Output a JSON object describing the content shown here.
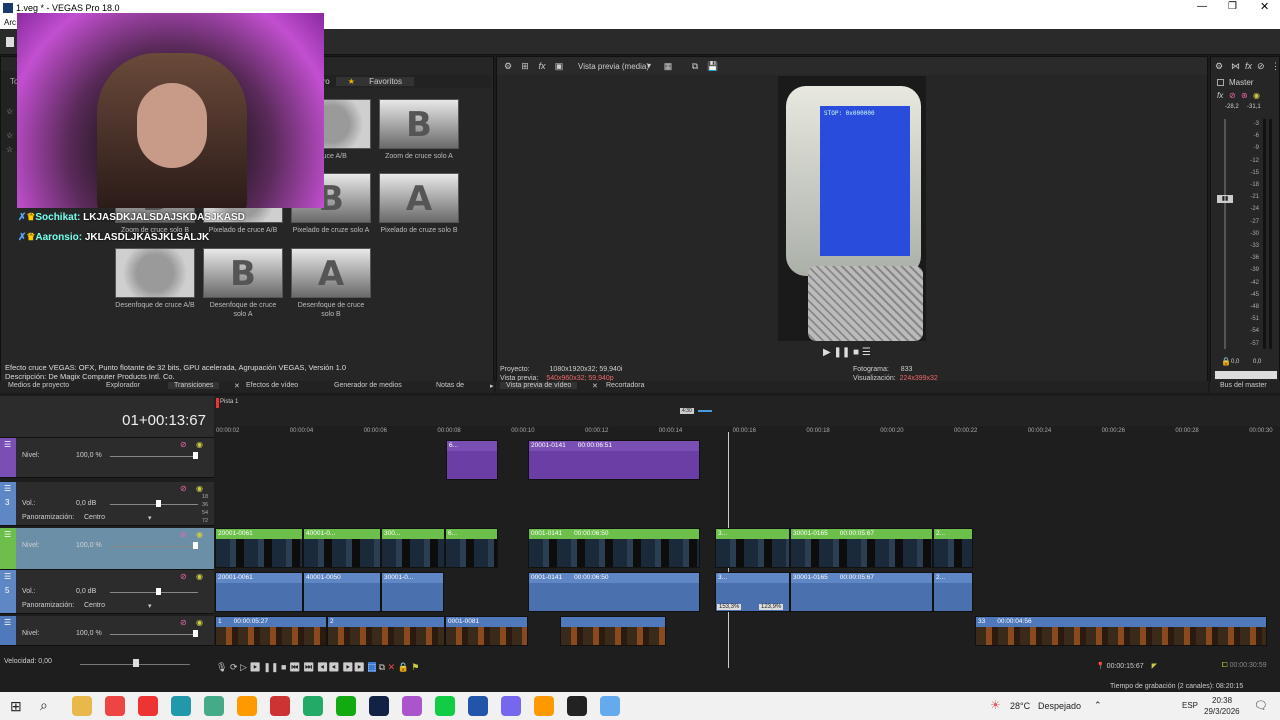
{
  "window": {
    "title": "1.veg * - VEGAS Pro 18.0",
    "menu_fragment": "Arc"
  },
  "transitions": {
    "partial_tabs": [
      "To",
      "ercero"
    ],
    "favorites_tab": "Favoritos",
    "items": [
      {
        "label": "Cruce A/B",
        "glyph": ""
      },
      {
        "label": "Zoom de cruce solo A",
        "glyph": "B"
      },
      {
        "label": "Zoom de cruce solo B",
        "glyph": "B"
      },
      {
        "label": "Pixelado de cruce A/B",
        "glyph": ""
      },
      {
        "label": "Pixelado de cruze solo A",
        "glyph": "B"
      },
      {
        "label": "Pixelado de cruze solo B",
        "glyph": "A"
      },
      {
        "label": "Desenfoque de cruce A/B",
        "glyph": ""
      },
      {
        "label": "Desenfoque de cruce solo A",
        "glyph": "B"
      },
      {
        "label": "Desenfoque de cruce solo B",
        "glyph": "A"
      }
    ],
    "desc1": "Efecto cruce VEGAS: OFX, Punto flotante de 32 bits, GPU acelerada, Agrupación VEGAS, Versión 1.0",
    "desc2": "Descripción: De Magix Computer Products Intl. Co.",
    "bottom_tabs": [
      "Medios de proyecto",
      "Explorador",
      "Transiciones",
      "Efectos de vídeo",
      "Generador de medios",
      "Notas de"
    ]
  },
  "chat": [
    {
      "user": "Sochikat:",
      "message": "LKJASDKJALSDAJSKDASJKASD"
    },
    {
      "user": "Aaronsio:",
      "message": "JKLASDLJKASJKLSALJK"
    }
  ],
  "preview": {
    "mode": "Vista previa (media)",
    "screen_text": "STOP: 0x000000",
    "project_label": "Proyecto:",
    "project_value": "1080x1920x32; 59,940i",
    "vista_label": "Vista previa:",
    "vista_value": "540x960x32; 59,940p",
    "frame_label": "Fotograma:",
    "frame_value": "833",
    "visual_label": "Visualización:",
    "visual_value": "224x399x32",
    "tabs": [
      "Vista previa de vídeo",
      "Recortadora"
    ]
  },
  "master": {
    "title": "Master",
    "left_peak": "-28,2",
    "right_peak": "-31,1",
    "scale": [
      "-3",
      "-6",
      "-9",
      "-12",
      "-15",
      "-18",
      "-21",
      "-24",
      "-27",
      "-30",
      "-33",
      "-36",
      "-39",
      "-42",
      "-45",
      "-48",
      "-51",
      "-54",
      "-57"
    ],
    "bottom_left": "0,0",
    "bottom_right": "0,0",
    "tab": "Bus del master"
  },
  "timeline": {
    "timecode": "01+00:13:67",
    "marker": "Pista 1",
    "loop_label": "4:30",
    "ruler": [
      "00:00:02",
      "00:00:04",
      "00:00:06",
      "00:00:08",
      "00:00:10",
      "00:00:12",
      "00:00:14",
      "00:00:16",
      "00:00:18",
      "00:00:20",
      "00:00:22",
      "00:00:24",
      "00:00:26",
      "00:00:28",
      "00:00:30"
    ],
    "tracks": [
      {
        "num": "",
        "label": "Nivel:",
        "value": "100,0 %"
      },
      {
        "num": "3",
        "label": "Vol.:",
        "value": "0,0 dB",
        "label2": "Panoramización:",
        "value2": "Centro"
      },
      {
        "num": "",
        "label": "Nivel:",
        "value": "100,0 %"
      },
      {
        "num": "5",
        "label": "Vol.:",
        "value": "0,0 dB",
        "label2": "Panoramización:",
        "value2": "Centro"
      },
      {
        "num": "",
        "label": "Nivel:",
        "value": "100,0 %"
      }
    ],
    "db_scale": [
      "18",
      "36",
      "54",
      "72"
    ],
    "clips": {
      "purple": [
        {
          "name": "6..."
        },
        {
          "name": "20001-0141",
          "time": "00:00:06:51"
        }
      ],
      "green": [
        {
          "name": "20001-0061"
        },
        {
          "name": "40001-0..."
        },
        {
          "name": "300..."
        },
        {
          "name": "6..."
        },
        {
          "name": "0001-0141",
          "time": "00:00:06:50"
        },
        {
          "name": "3..."
        },
        {
          "name": "30001-0165",
          "time": "00:00:05:67"
        },
        {
          "name": "2..."
        }
      ],
      "audio": [
        {
          "name": "20001-0061"
        },
        {
          "name": "40001-0050"
        },
        {
          "name": "30001-0..."
        },
        {
          "name": "0001-0141",
          "time": "00:00:06:50"
        },
        {
          "name": "3..."
        },
        {
          "name": "30001-0165",
          "time": "00:00:05:67"
        },
        {
          "name": "2..."
        }
      ],
      "audio_pct": [
        "153,3%",
        "123,9%"
      ],
      "blue": [
        {
          "name": "1",
          "time": "00:00:05:27"
        },
        {
          "name": "2"
        },
        {
          "name": "0001-0081"
        },
        {
          "name": "33",
          "time": "00:00:04:56"
        }
      ]
    },
    "speed_label": "Velocidad: 0,00",
    "cursor_time": "00:00:15:67",
    "end_time": "00:00:30:59",
    "rec_time": "Tiempo de grabación (2 canales): 08:20:15"
  },
  "taskbar": {
    "temp": "28°C",
    "weather": "Despejado",
    "lang": "ESP",
    "time": "20:38",
    "date": "29/3/2026"
  }
}
